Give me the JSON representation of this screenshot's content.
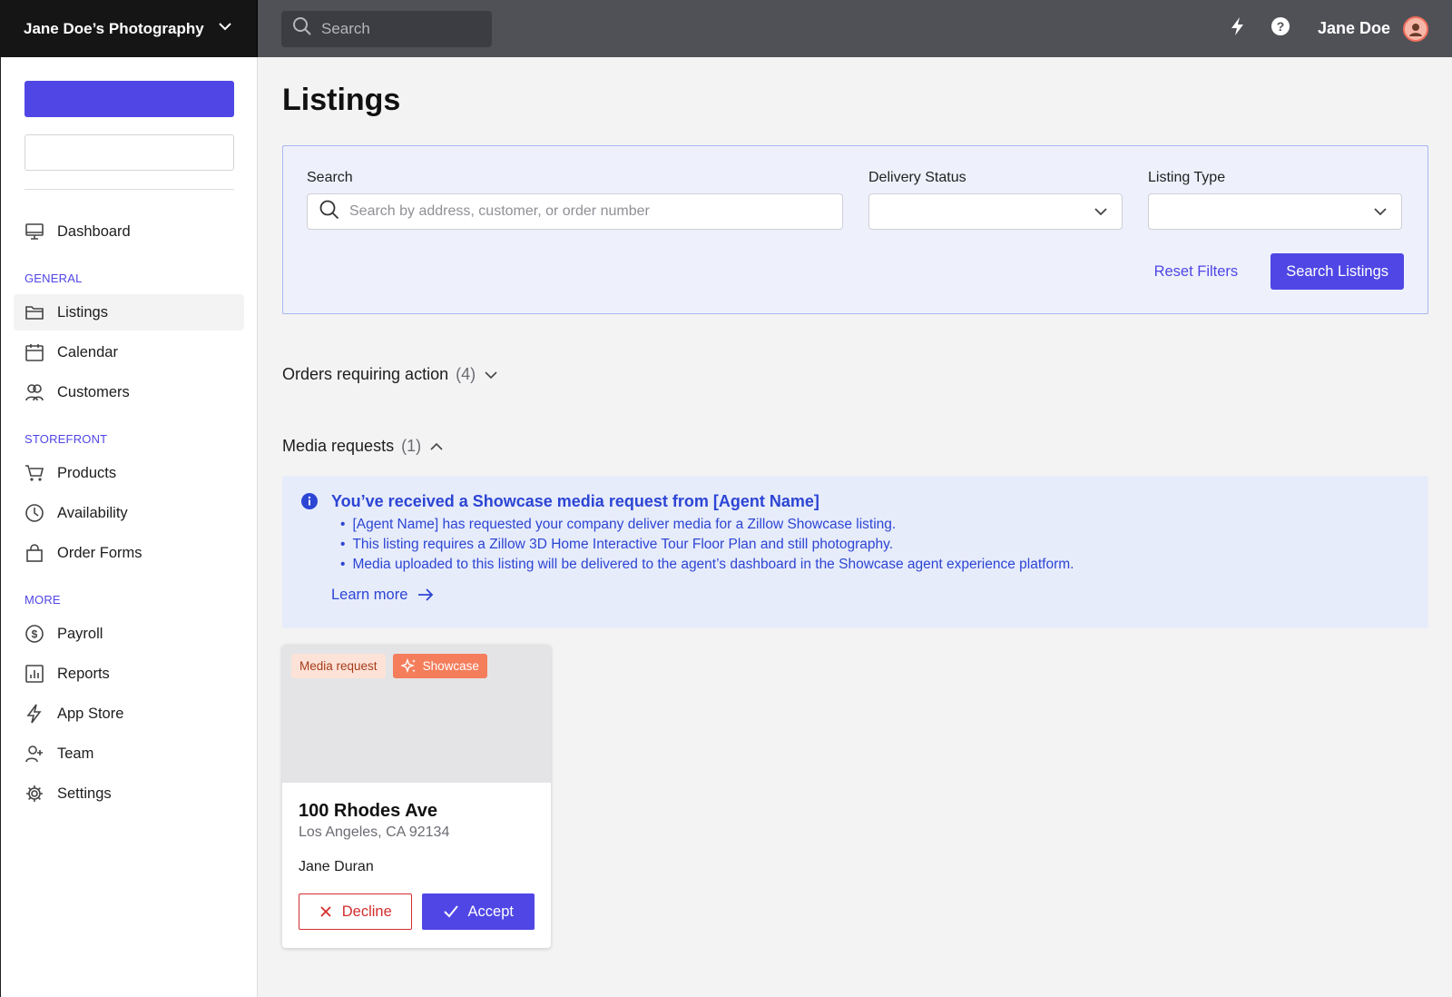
{
  "brand": {
    "name": "Jane Doe’s Photography"
  },
  "topbar": {
    "search_placeholder": "Search",
    "user_name": "Jane Doe"
  },
  "sidebar": {
    "dashboard": "Dashboard",
    "sections": {
      "general": "GENERAL",
      "storefront": "STOREFRONT",
      "more": "MORE"
    },
    "general_items": [
      "Listings",
      "Calendar",
      "Customers"
    ],
    "storefront_items": [
      "Products",
      "Availability",
      "Order Forms"
    ],
    "more_items": [
      "Payroll",
      "Reports",
      "App Store",
      "Team",
      "Settings"
    ]
  },
  "main": {
    "title": "Listings",
    "filters": {
      "search_label": "Search",
      "search_placeholder": "Search by address, customer, or order number",
      "delivery_status_label": "Delivery Status",
      "listing_type_label": "Listing Type",
      "reset_label": "Reset Filters",
      "submit_label": "Search Listings"
    },
    "orders_requiring_action": {
      "label": "Orders requiring action",
      "count": "(4)"
    },
    "media_requests": {
      "label": "Media requests",
      "count": "(1)"
    },
    "info": {
      "title": "You’ve received a Showcase media request from [Agent Name]",
      "bullets": [
        "[Agent Name] has requested your company deliver media for a Zillow Showcase listing.",
        "This listing requires a Zillow 3D Home Interactive Tour Floor Plan and still photography.",
        "Media uploaded to this listing will be delivered to the agent’s dashboard in the Showcase agent experience platform."
      ],
      "learn_more": "Learn more"
    },
    "card": {
      "badge_media": "Media request",
      "badge_showcase": "Showcase",
      "address": "100 Rhodes Ave",
      "city": "Los Angeles, CA 92134",
      "agent": "Jane Duran",
      "decline_label": "Decline",
      "accept_label": "Accept"
    }
  },
  "colors": {
    "accent": "#4f46e5",
    "showcase": "#f47d5b",
    "decline": "#d42d2d",
    "info_text": "#2c45d4"
  }
}
